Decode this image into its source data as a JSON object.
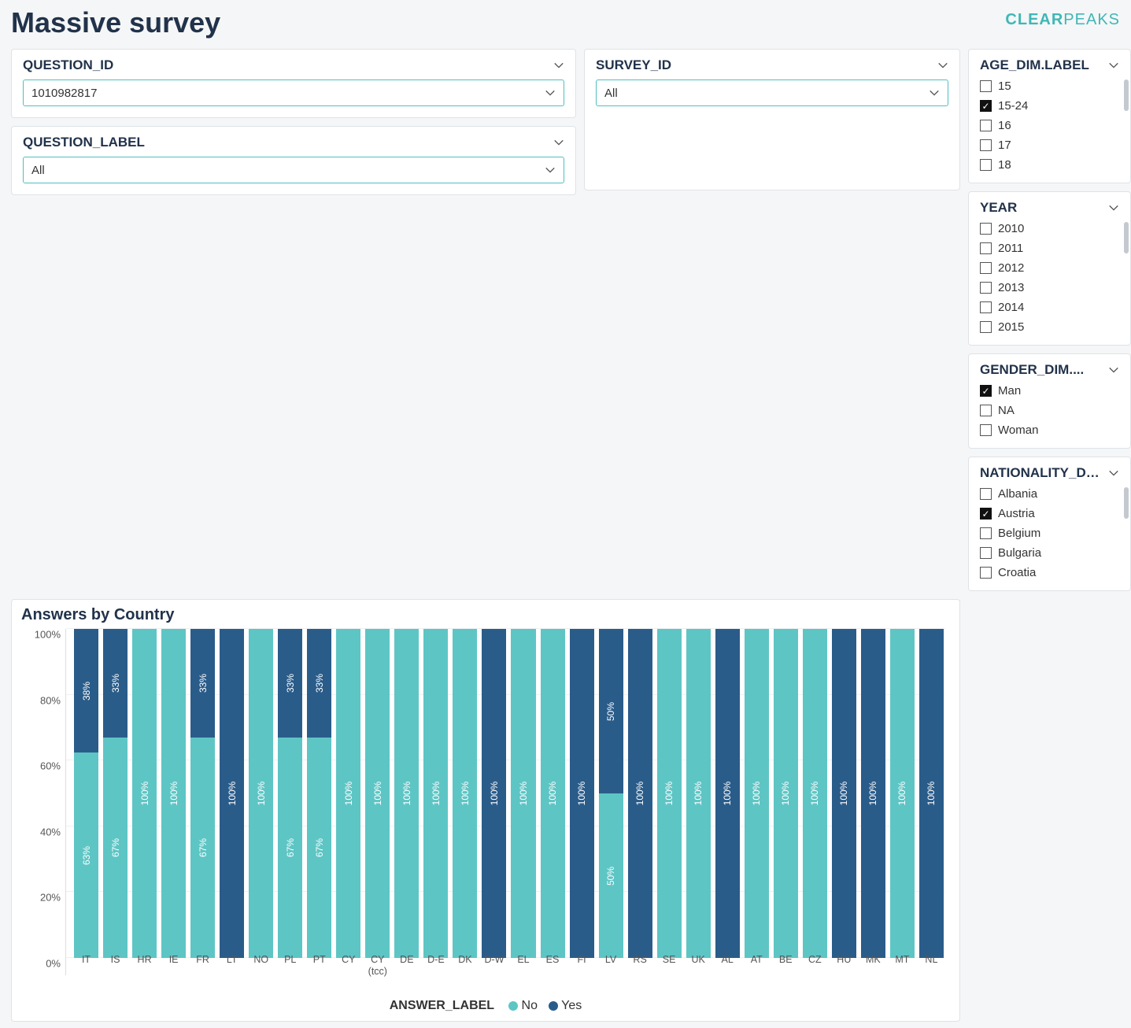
{
  "page_title": "Massive survey",
  "logo": {
    "part1": "CLEAR",
    "part2": "PEAKS"
  },
  "filters": {
    "question_id": {
      "label": "QUESTION_ID",
      "value": "1010982817"
    },
    "question_label": {
      "label": "QUESTION_LABEL",
      "value": "All"
    },
    "survey_id": {
      "label": "SURVEY_ID",
      "value": "All"
    }
  },
  "facets": {
    "age": {
      "label": "AGE_DIM.LABEL",
      "items": [
        {
          "label": "15",
          "checked": false
        },
        {
          "label": "15-24",
          "checked": true
        },
        {
          "label": "16",
          "checked": false
        },
        {
          "label": "17",
          "checked": false
        },
        {
          "label": "18",
          "checked": false
        }
      ]
    },
    "year": {
      "label": "YEAR",
      "items": [
        {
          "label": "2010",
          "checked": false
        },
        {
          "label": "2011",
          "checked": false
        },
        {
          "label": "2012",
          "checked": false
        },
        {
          "label": "2013",
          "checked": false
        },
        {
          "label": "2014",
          "checked": false
        },
        {
          "label": "2015",
          "checked": false
        }
      ]
    },
    "gender": {
      "label": "GENDER_DIM....",
      "items": [
        {
          "label": "Man",
          "checked": true
        },
        {
          "label": "NA",
          "checked": false
        },
        {
          "label": "Woman",
          "checked": false
        }
      ]
    },
    "nat": {
      "label": "NATIONALITY_D…",
      "items": [
        {
          "label": "Albania",
          "checked": false
        },
        {
          "label": "Austria",
          "checked": true
        },
        {
          "label": "Belgium",
          "checked": false
        },
        {
          "label": "Bulgaria",
          "checked": false
        },
        {
          "label": "Croatia",
          "checked": false
        }
      ]
    }
  },
  "chart_data": {
    "type": "bar",
    "stacked": true,
    "title": "Answers by Country",
    "xlabel": "",
    "ylabel": "",
    "ylim": [
      0,
      100
    ],
    "yticks": [
      "0%",
      "20%",
      "40%",
      "60%",
      "80%",
      "100%"
    ],
    "legend_title": "ANSWER_LABEL",
    "series_names": [
      "No",
      "Yes"
    ],
    "series_colors": [
      "#5ec5c5",
      "#2a5c8a"
    ],
    "categories": [
      "IT",
      "IS",
      "HR",
      "IE",
      "FR",
      "LT",
      "NO",
      "PL",
      "PT",
      "CY",
      "CY (tcc)",
      "DE",
      "D-E",
      "DK",
      "D-W",
      "EL",
      "ES",
      "FI",
      "LV",
      "RS",
      "SE",
      "UK",
      "AL",
      "AT",
      "BE",
      "CZ",
      "HU",
      "MK",
      "MT",
      "NL"
    ],
    "data": [
      {
        "cat": "IT",
        "no": 63,
        "yes": 38,
        "no_is_yes_color": false,
        "hide_label": false
      },
      {
        "cat": "IS",
        "no": 67,
        "yes": 33,
        "no_is_yes_color": false,
        "hide_label": false
      },
      {
        "cat": "HR",
        "no": 100,
        "yes": 0,
        "no_is_yes_color": false,
        "hide_label": false
      },
      {
        "cat": "IE",
        "no": 100,
        "yes": 0,
        "no_is_yes_color": false,
        "hide_label": false
      },
      {
        "cat": "FR",
        "no": 67,
        "yes": 33,
        "no_is_yes_color": false,
        "hide_label": false
      },
      {
        "cat": "LT",
        "no": 100,
        "yes": 0,
        "no_is_yes_color": true,
        "hide_label": false
      },
      {
        "cat": "NO",
        "no": 100,
        "yes": 0,
        "no_is_yes_color": false,
        "hide_label": false
      },
      {
        "cat": "PL",
        "no": 67,
        "yes": 33,
        "no_is_yes_color": false,
        "hide_label": false
      },
      {
        "cat": "PT",
        "no": 67,
        "yes": 33,
        "no_is_yes_color": false,
        "hide_label": false
      },
      {
        "cat": "CY",
        "no": 100,
        "yes": 0,
        "no_is_yes_color": false,
        "hide_label": false
      },
      {
        "cat": "CY (tcc)",
        "no": 100,
        "yes": 0,
        "no_is_yes_color": false,
        "hide_label": false
      },
      {
        "cat": "DE",
        "no": 100,
        "yes": 0,
        "no_is_yes_color": false,
        "hide_label": false
      },
      {
        "cat": "D-E",
        "no": 100,
        "yes": 0,
        "no_is_yes_color": false,
        "hide_label": false
      },
      {
        "cat": "DK",
        "no": 100,
        "yes": 0,
        "no_is_yes_color": false,
        "hide_label": false
      },
      {
        "cat": "D-W",
        "no": 100,
        "yes": 0,
        "no_is_yes_color": true,
        "hide_label": false
      },
      {
        "cat": "EL",
        "no": 100,
        "yes": 0,
        "no_is_yes_color": false,
        "hide_label": false
      },
      {
        "cat": "ES",
        "no": 100,
        "yes": 0,
        "no_is_yes_color": false,
        "hide_label": false
      },
      {
        "cat": "FI",
        "no": 100,
        "yes": 0,
        "no_is_yes_color": true,
        "hide_label": false
      },
      {
        "cat": "LV",
        "no": 50,
        "yes": 50,
        "no_is_yes_color": false,
        "hide_label": false
      },
      {
        "cat": "RS",
        "no": 100,
        "yes": 0,
        "no_is_yes_color": true,
        "hide_label": false
      },
      {
        "cat": "SE",
        "no": 100,
        "yes": 0,
        "no_is_yes_color": false,
        "hide_label": false
      },
      {
        "cat": "UK",
        "no": 100,
        "yes": 0,
        "no_is_yes_color": false,
        "hide_label": false
      },
      {
        "cat": "AL",
        "no": 100,
        "yes": 0,
        "no_is_yes_color": true,
        "hide_label": false
      },
      {
        "cat": "AT",
        "no": 100,
        "yes": 0,
        "no_is_yes_color": false,
        "hide_label": false
      },
      {
        "cat": "BE",
        "no": 100,
        "yes": 0,
        "no_is_yes_color": false,
        "hide_label": false
      },
      {
        "cat": "CZ",
        "no": 100,
        "yes": 0,
        "no_is_yes_color": false,
        "hide_label": false
      },
      {
        "cat": "HU",
        "no": 100,
        "yes": 0,
        "no_is_yes_color": true,
        "hide_label": false
      },
      {
        "cat": "MK",
        "no": 100,
        "yes": 0,
        "no_is_yes_color": true,
        "hide_label": false
      },
      {
        "cat": "MT",
        "no": 100,
        "yes": 0,
        "no_is_yes_color": false,
        "hide_label": false
      },
      {
        "cat": "NL",
        "no": 100,
        "yes": 0,
        "no_is_yes_color": true,
        "hide_label": false
      }
    ]
  }
}
